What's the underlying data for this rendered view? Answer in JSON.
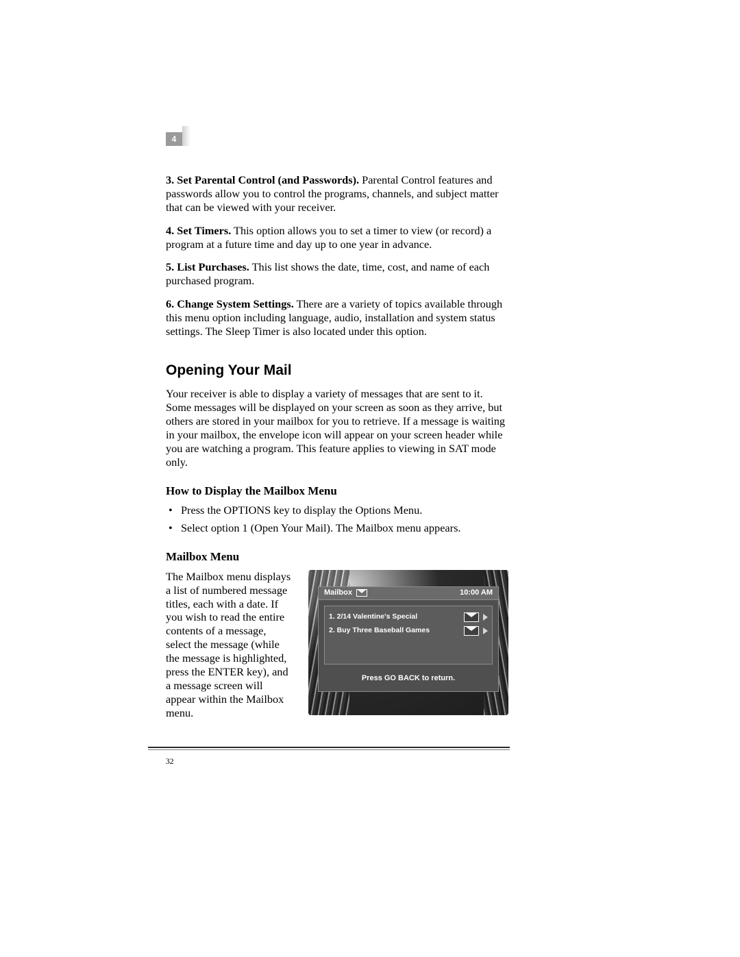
{
  "chapter_tab": "4",
  "page_number": "32",
  "p3": {
    "num": "3. ",
    "title": "Set Parental Control (and Passwords).",
    "text": "  Parental Control features and passwords allow you to control the programs, channels, and subject matter that can be viewed with your receiver."
  },
  "p4": {
    "num": "4. ",
    "title": "Set Timers.",
    "text": " This option allows you to set a timer to view (or record) a program at a future time and day up to one year in advance."
  },
  "p5": {
    "num": "5. ",
    "title": "List Purchases.",
    "text": " This list shows the date, time, cost, and name of each purchased program."
  },
  "p6": {
    "num": "6. ",
    "title": "Change System Settings.",
    "text": " There are a variety of topics available through this menu option including language, audio, installation and system status settings. The Sleep Timer is also located under this option."
  },
  "section_heading": "Opening Your Mail",
  "section_intro": "Your receiver is able to display a variety of messages that are sent to it. Some messages will be displayed on your screen as soon as they arrive, but others are stored in your mailbox for you to retrieve. If a message is waiting in your mailbox, the envelope icon will appear on your screen header while you are watching a program. This feature applies to viewing in SAT mode only.",
  "howto_heading": "How to Display the Mailbox Menu",
  "howto_items": [
    "Press the OPTIONS key to display the Options Menu.",
    "Select option 1 (Open Your Mail). The Mailbox menu appears."
  ],
  "mailbox_heading": "Mailbox Menu",
  "mailbox_text": "The Mailbox menu displays a list of numbered message titles, each with a date. If you wish to read the entire contents of a message, select the message (while the message is highlighted, press the ENTER key), and a message screen will appear within the Mailbox menu.",
  "osd": {
    "title": "Mailbox",
    "time": "10:00 AM",
    "rows": [
      "1. 2/14 Valentine's Special",
      "2. Buy Three Baseball Games"
    ],
    "footer": "Press GO BACK to return."
  }
}
